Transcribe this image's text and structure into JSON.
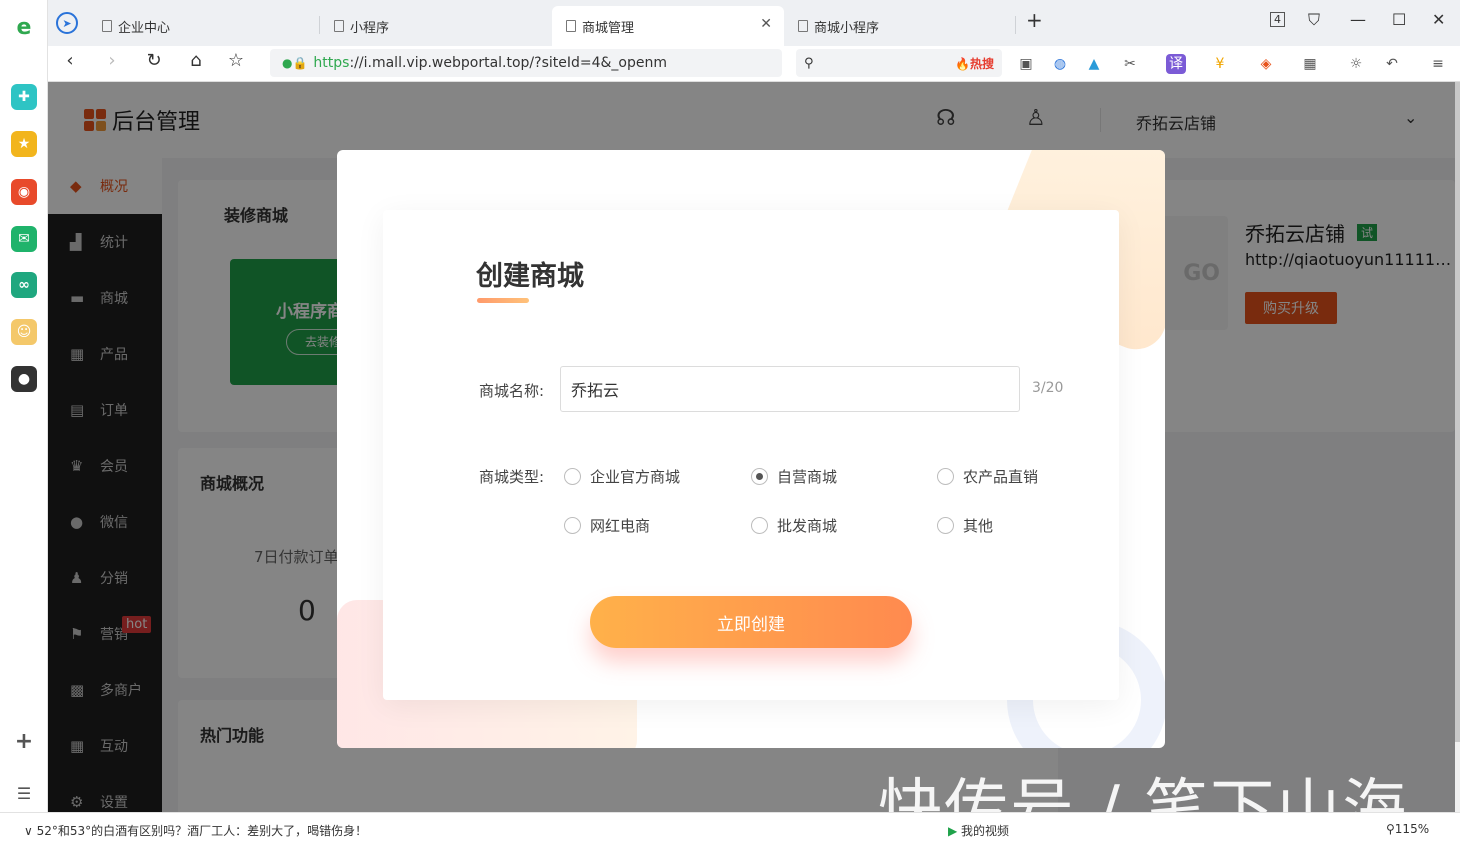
{
  "browser": {
    "tabs": [
      {
        "label": "企业中心"
      },
      {
        "label": "小程序"
      },
      {
        "label": "商城管理"
      },
      {
        "label": "商城小程序"
      }
    ],
    "tab_count": "4",
    "url_https": "https",
    "url_rest": "://i.mall.vip.webportal.top/?siteId=4&_openm",
    "search_hot": "🔥热搜",
    "status_news": "52°和53°的白酒有区别吗？酒厂工人：差别大了，喝错伤身！",
    "status_video": "我的视频",
    "zoom": "115%"
  },
  "app": {
    "title": "后台管理",
    "shop_name": "乔拓云店铺",
    "sidebar": [
      {
        "label": "概况"
      },
      {
        "label": "统计"
      },
      {
        "label": "商城"
      },
      {
        "label": "产品"
      },
      {
        "label": "订单"
      },
      {
        "label": "会员"
      },
      {
        "label": "微信"
      },
      {
        "label": "分销"
      },
      {
        "label": "营销"
      },
      {
        "label": "多商户"
      },
      {
        "label": "互动"
      },
      {
        "label": "设置"
      }
    ],
    "hot_badge": "hot",
    "cards": {
      "decorate_title": "装修商城",
      "mini_program": "小程序商",
      "go_decorate": "去装修",
      "overview_title": "商城概况",
      "paid_orders_label": "7日付款订单",
      "paid_orders_value": "0",
      "hot_features_title": "热门功能"
    },
    "shop_info": {
      "name": "乔拓云店铺",
      "trial": "试",
      "url": "http://qiaotuoyun11111-...",
      "upgrade": "购买升级",
      "logo_text": "GO"
    }
  },
  "modal": {
    "title": "创建商城",
    "name_label": "商城名称:",
    "name_value": "乔拓云",
    "name_counter": "3/20",
    "type_label": "商城类型:",
    "types": [
      {
        "label": "企业官方商城",
        "selected": false
      },
      {
        "label": "自营商城",
        "selected": true
      },
      {
        "label": "农产品直销",
        "selected": false
      },
      {
        "label": "网红电商",
        "selected": false
      },
      {
        "label": "批发商城",
        "selected": false
      },
      {
        "label": "其他",
        "selected": false
      }
    ],
    "submit": "立即创建"
  },
  "watermark": "快传号 / 笔下山海",
  "colors": {
    "accent": "#e8531b",
    "green": "#1fa24a",
    "button_start": "#ffb14a",
    "button_end": "#ff8a4f"
  }
}
